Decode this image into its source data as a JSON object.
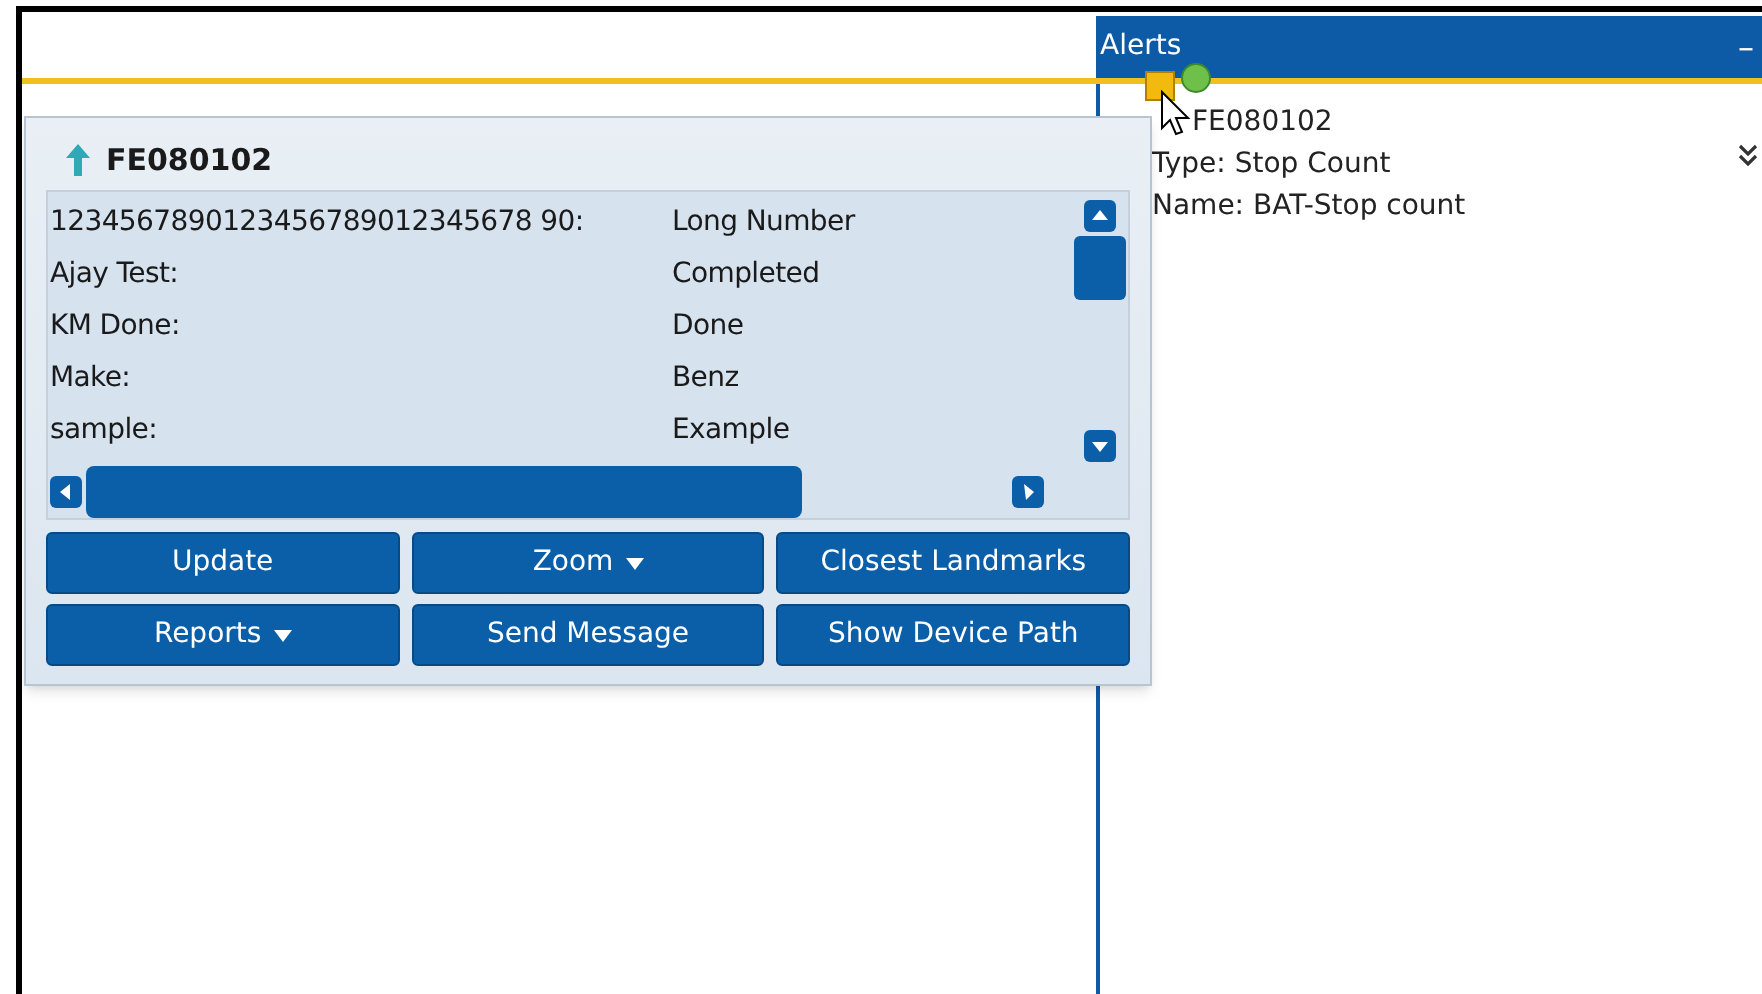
{
  "alerts_panel": {
    "title": "Alerts",
    "minimize": "–",
    "alerts": [
      {
        "device": "FE080102",
        "type": "Type: Stop Count",
        "name": "Name: BAT-Stop count"
      }
    ]
  },
  "popup": {
    "title": "FE080102",
    "rows": [
      {
        "label": "1234567890123456789012345678 90:",
        "value": "Long Number"
      },
      {
        "label": "Ajay Test:",
        "value": "Completed"
      },
      {
        "label": "KM Done:",
        "value": "Done"
      },
      {
        "label": "Make:",
        "value": "Benz"
      },
      {
        "label": "sample:",
        "value": "Example"
      }
    ],
    "buttons": [
      {
        "label": "Update",
        "dropdown": false
      },
      {
        "label": "Zoom",
        "dropdown": true
      },
      {
        "label": "Closest Landmarks",
        "dropdown": false
      },
      {
        "label": "Reports",
        "dropdown": true
      },
      {
        "label": "Send Message",
        "dropdown": false
      },
      {
        "label": "Show Device Path",
        "dropdown": false
      }
    ]
  }
}
